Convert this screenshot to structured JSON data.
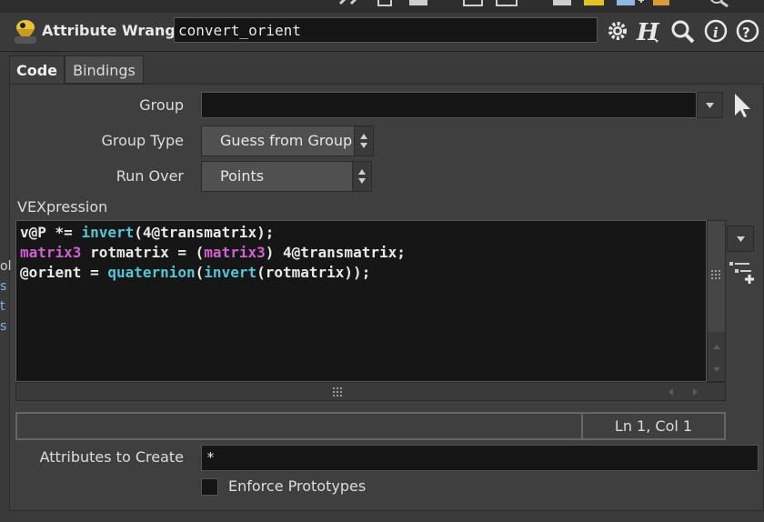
{
  "header": {
    "node_type_label": "Attribute Wrangle",
    "node_name": "convert_orient",
    "icons": [
      "gear-icon",
      "help-h-icon",
      "search-icon",
      "info-icon",
      "help-question-icon"
    ]
  },
  "tabs": [
    {
      "label": "Code",
      "active": true
    },
    {
      "label": "Bindings",
      "active": false
    }
  ],
  "params": {
    "group": {
      "label": "Group",
      "value": ""
    },
    "group_type": {
      "label": "Group Type",
      "value": "Guess from Group"
    },
    "run_over": {
      "label": "Run Over",
      "value": "Points"
    },
    "vexpression_label": "VEXpression",
    "code_lines": [
      [
        {
          "t": "v@P *= ",
          "c": "plain"
        },
        {
          "t": "invert",
          "c": "fn"
        },
        {
          "t": "(4@transmatrix);",
          "c": "plain"
        }
      ],
      [
        {
          "t": "matrix3",
          "c": "kw"
        },
        {
          "t": " rotmatrix = (",
          "c": "plain"
        },
        {
          "t": "matrix3",
          "c": "kw"
        },
        {
          "t": ") 4@transmatrix;",
          "c": "plain"
        }
      ],
      [
        {
          "t": "@orient = ",
          "c": "plain"
        },
        {
          "t": "quaternion",
          "c": "fn"
        },
        {
          "t": "(",
          "c": "plain"
        },
        {
          "t": "invert",
          "c": "fn"
        },
        {
          "t": "(rotmatrix));",
          "c": "plain"
        }
      ]
    ],
    "cursor_position": "Ln 1, Col 1",
    "attributes_to_create": {
      "label": "Attributes to Create",
      "value": "*"
    },
    "enforce_prototypes": {
      "label": "Enforce Prototypes",
      "checked": false
    }
  },
  "colors": {
    "keyword": "#d25fd2",
    "function": "#52c6d2",
    "background": "#3a3a3a",
    "field": "#151515"
  }
}
